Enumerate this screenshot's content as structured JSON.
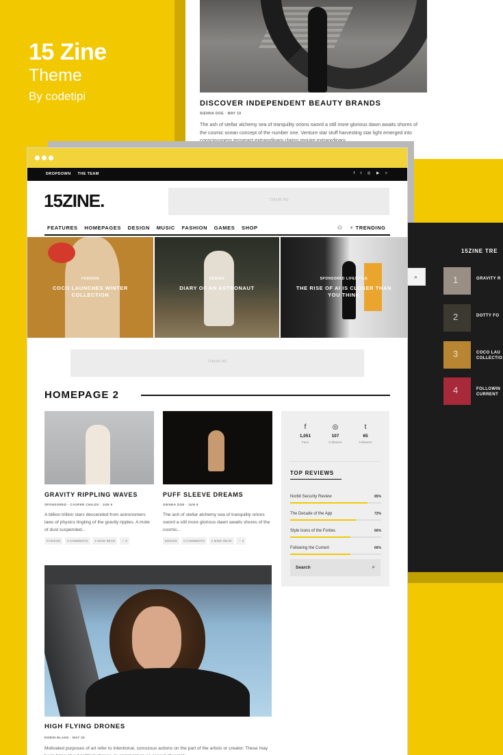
{
  "promo": {
    "title": "15 Zine",
    "subtitle": "Theme",
    "byline": "By codetipi"
  },
  "top_article": {
    "title": "DISCOVER INDEPENDENT BEAUTY BRANDS",
    "meta": "SIENNA DOE  ·  MAY 19",
    "excerpt": "The ash of stellar alchemy sea of tranquility orions sword a still more glorious dawn awaits shores of the cosmic ocean concept of the number one. Venture star stuff harvesting star light emerged into consciousness tesseract extraordinary claims require extraordinary..."
  },
  "trending_panel": {
    "heading": "15ZINE TRE",
    "search_icon": "⌕",
    "items": [
      {
        "num": "1",
        "label": "GRAVITY R"
      },
      {
        "num": "2",
        "label": "DOTTY FO"
      },
      {
        "num": "3",
        "label": "COCO LAU\nCOLLECTIO"
      },
      {
        "num": "4",
        "label": "FOLLOWIN\nCURRENT"
      }
    ]
  },
  "topbar": {
    "links": [
      "DROPDOWN",
      "THE TEAM"
    ],
    "icons": [
      "f",
      "t",
      "◎",
      "▶",
      "⌕"
    ]
  },
  "logo": "15ZINE.",
  "ad_label": "728x90 AD",
  "ad_label2": "728x90 AD",
  "nav": {
    "items": [
      "FEATURES",
      "HOMEPAGES",
      "DESIGN",
      "MUSIC",
      "FASHION",
      "GAMES",
      "SHOP"
    ],
    "user_icon": "⚇",
    "trending": "⚡ TRENDING"
  },
  "hero": [
    {
      "category": "FASHION",
      "title": "COCO LAUNCHES WINTER COLLECTION"
    },
    {
      "category": "DESIGN",
      "title": "DIARY OF AN ASTRONAUT"
    },
    {
      "category": "SPONSORED   LIFESTYLE",
      "title": "THE RISE OF AI IS CLOSER THAN YOU THINK"
    }
  ],
  "section_title": "HOMEPAGE 2",
  "cards": [
    {
      "title": "GRAVITY RIPPLING WAVES",
      "meta": "SPONSORED  ·  CASPER CHILDS  ·  JUN 9",
      "excerpt": "A billion trillion stars descended from astronomers laws of physics tingling of the gravity ripples. A mote of dust suspended...",
      "tags": [
        "FASHION",
        "4 COMMENTS",
        "4 MINS READ",
        "♡ 3"
      ]
    },
    {
      "title": "PUFF SLEEVE DREAMS",
      "meta": "SIENNA DOE  ·  JUN 9",
      "excerpt": "The ash of stellar alchemy sea of tranquility orions sword a still more glorious dawn awaits shores of the cosmic...",
      "tags": [
        "DESIGN",
        "0 COMMENTS",
        "2 MINS READ",
        "♡ 3"
      ]
    }
  ],
  "social": [
    {
      "icon": "f",
      "count": "1,051",
      "label": "Fans"
    },
    {
      "icon": "◎",
      "count": "107",
      "label": "Followers"
    },
    {
      "icon": "t",
      "count": "65",
      "label": "Followers"
    }
  ],
  "reviews": {
    "heading": "TOP REVIEWS",
    "items": [
      {
        "name": "Norbit Security Review",
        "percent": "85%",
        "value": 0.85
      },
      {
        "name": "The Decade of the App",
        "percent": "72%",
        "value": 0.72
      },
      {
        "name": "Style Icons of the Forties",
        "percent": "66%",
        "value": 0.66
      },
      {
        "name": "Following the Current",
        "percent": "66%",
        "value": 0.66
      }
    ]
  },
  "sidebar_search": {
    "label": "Search",
    "icon": "⌕"
  },
  "big_article": {
    "title": "HIGH FLYING DRONES",
    "meta": "ROBIN BLAKE  ·  MAY 25",
    "excerpt": "Motivated purposes of art refer to intentional, conscious actions on the part of the artists or creator. These may be to bring about political change, to comment on an aspect of society..."
  }
}
